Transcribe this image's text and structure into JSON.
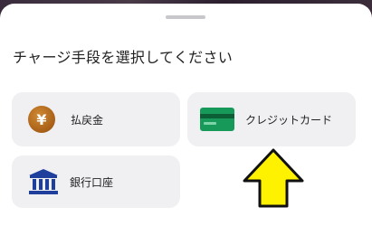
{
  "sheet": {
    "title": "チャージ手段を選択してください"
  },
  "options": {
    "refund": {
      "label": "払戻金",
      "icon": "yen-coin-icon"
    },
    "credit_card": {
      "label": "クレジットカード",
      "icon": "credit-card-icon"
    },
    "bank": {
      "label": "銀行口座",
      "icon": "bank-icon"
    }
  },
  "colors": {
    "card_background": "#f0f0f3",
    "coin": "#b5691d",
    "credit_card": "#17995a",
    "bank": "#1e3f9c",
    "annotation_arrow": "#fff200"
  },
  "coin_symbol": "¥"
}
